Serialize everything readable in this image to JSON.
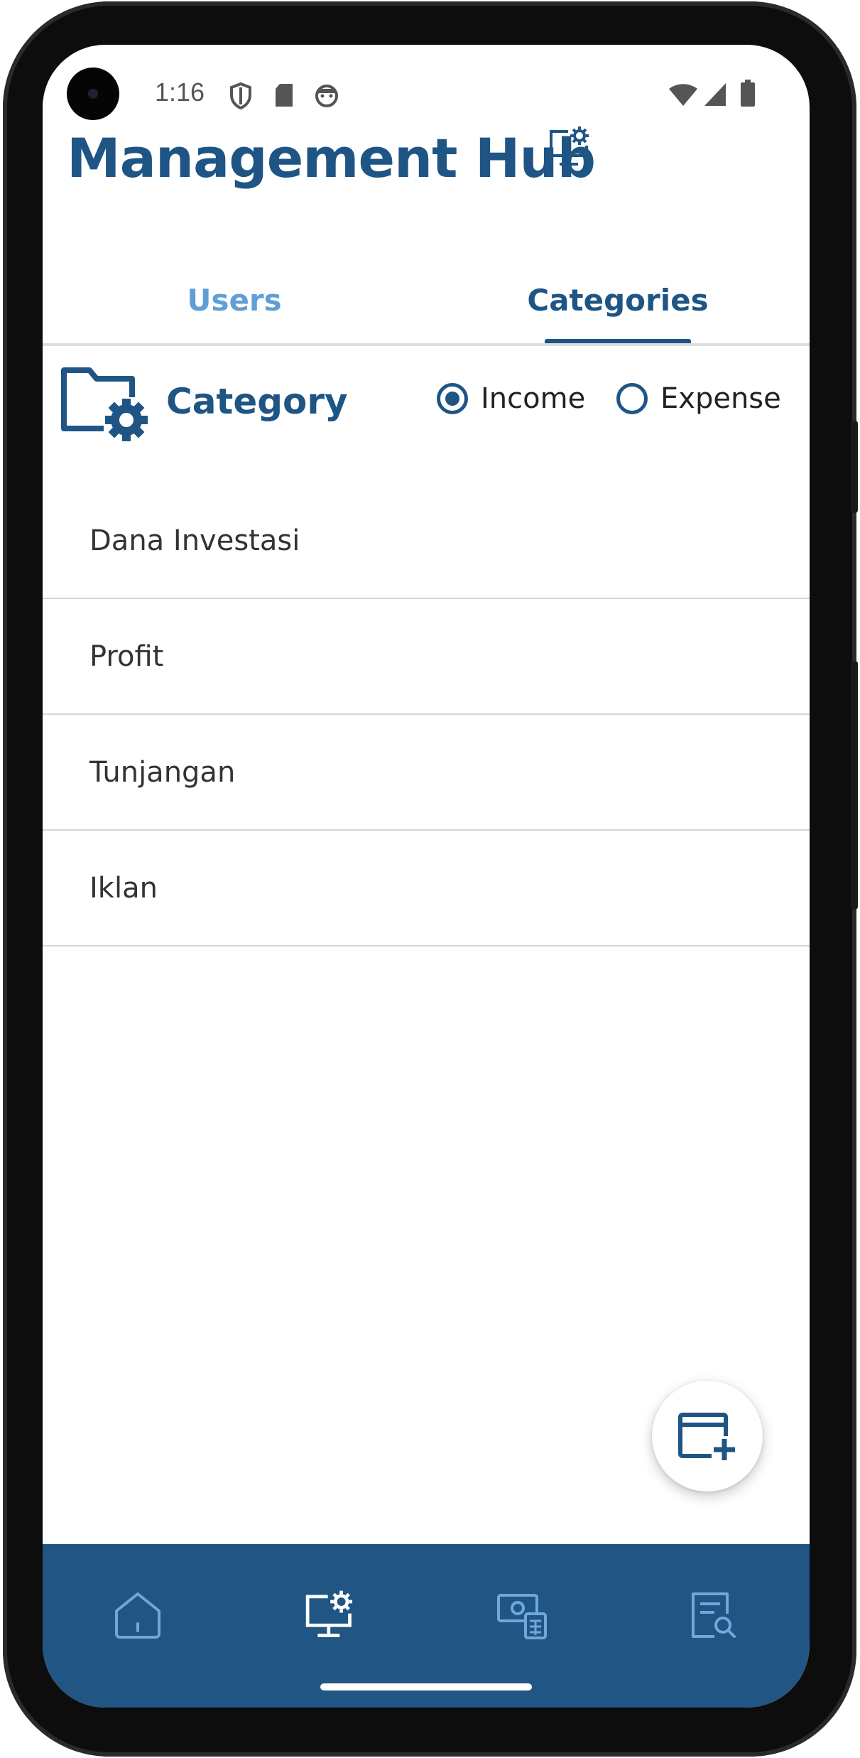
{
  "status_bar": {
    "time": "1:16",
    "icons": [
      "shield-icon",
      "sd-card-icon",
      "android-face-icon",
      "wifi-icon",
      "signal-icon",
      "battery-icon"
    ]
  },
  "header": {
    "title": "Management Hub",
    "icon": "monitor-gear-icon"
  },
  "tabs": [
    {
      "label": "Users",
      "selected": false
    },
    {
      "label": "Categories",
      "selected": true
    }
  ],
  "category_section": {
    "label": "Category",
    "icon": "folder-gear-icon",
    "radio_options": [
      {
        "label": "Income",
        "checked": true
      },
      {
        "label": "Expense",
        "checked": false
      }
    ]
  },
  "categories": [
    {
      "name": "Dana Investasi"
    },
    {
      "name": "Profit"
    },
    {
      "name": "Tunjangan"
    },
    {
      "name": "Iklan"
    }
  ],
  "fab": {
    "icon": "add-window-icon"
  },
  "bottom_nav": [
    {
      "icon": "home-icon",
      "active": false
    },
    {
      "icon": "monitor-gear-icon",
      "active": true
    },
    {
      "icon": "money-calculator-icon",
      "active": false
    },
    {
      "icon": "report-search-icon",
      "active": false
    }
  ],
  "colors": {
    "primary": "#1f5585",
    "tab_inactive": "#5f9fd6",
    "nav_background": "#215583",
    "nav_icon_inactive": "#6ea8dc"
  }
}
